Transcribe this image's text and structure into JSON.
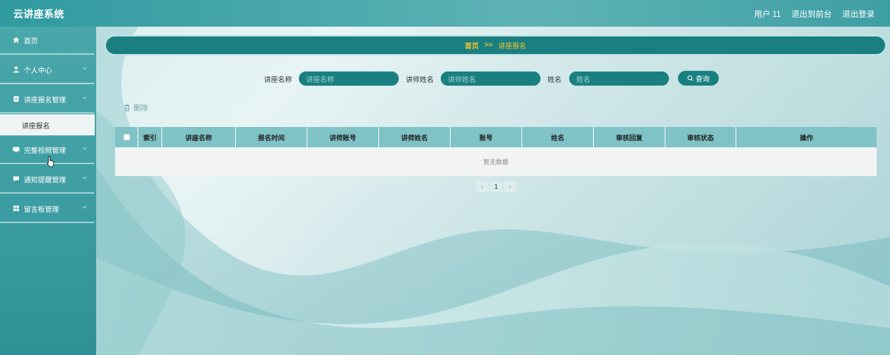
{
  "app": {
    "title": "云讲座系统"
  },
  "header": {
    "user_label": "用户 11",
    "front_link": "退出到前台",
    "logout_link": "退出登录"
  },
  "sidebar": {
    "items": [
      {
        "label": "首页",
        "icon": "home-icon"
      },
      {
        "label": "个人中心",
        "icon": "user-icon"
      },
      {
        "label": "讲座报名管理",
        "icon": "document-icon"
      },
      {
        "label": "完整视频管理",
        "icon": "monitor-icon"
      },
      {
        "label": "通知提醒管理",
        "icon": "message-icon"
      },
      {
        "label": "留言板管理",
        "icon": "grid-icon"
      }
    ],
    "active_sub": "讲座报名"
  },
  "breadcrumb": {
    "home": "首页",
    "separator": ">>",
    "current": "讲座报名"
  },
  "search": {
    "fields": [
      {
        "label": "讲座名称",
        "placeholder": "讲座名称"
      },
      {
        "label": "讲师姓名",
        "placeholder": "讲师姓名"
      },
      {
        "label": "姓名",
        "placeholder": "姓名"
      }
    ],
    "button_label": "查询"
  },
  "toolbar": {
    "delete_label": "删除"
  },
  "table": {
    "columns": [
      "索引",
      "讲座名称",
      "报名时间",
      "讲师账号",
      "讲师姓名",
      "账号",
      "姓名",
      "审核回复",
      "审核状态",
      "操作"
    ],
    "empty_text": "暂无数据"
  },
  "pagination": {
    "prev": "‹",
    "current_page": "1",
    "next": "›"
  },
  "colors": {
    "accent": "#1a7f80",
    "highlight": "#f4c531",
    "header_bg": "#7fc3c6"
  }
}
